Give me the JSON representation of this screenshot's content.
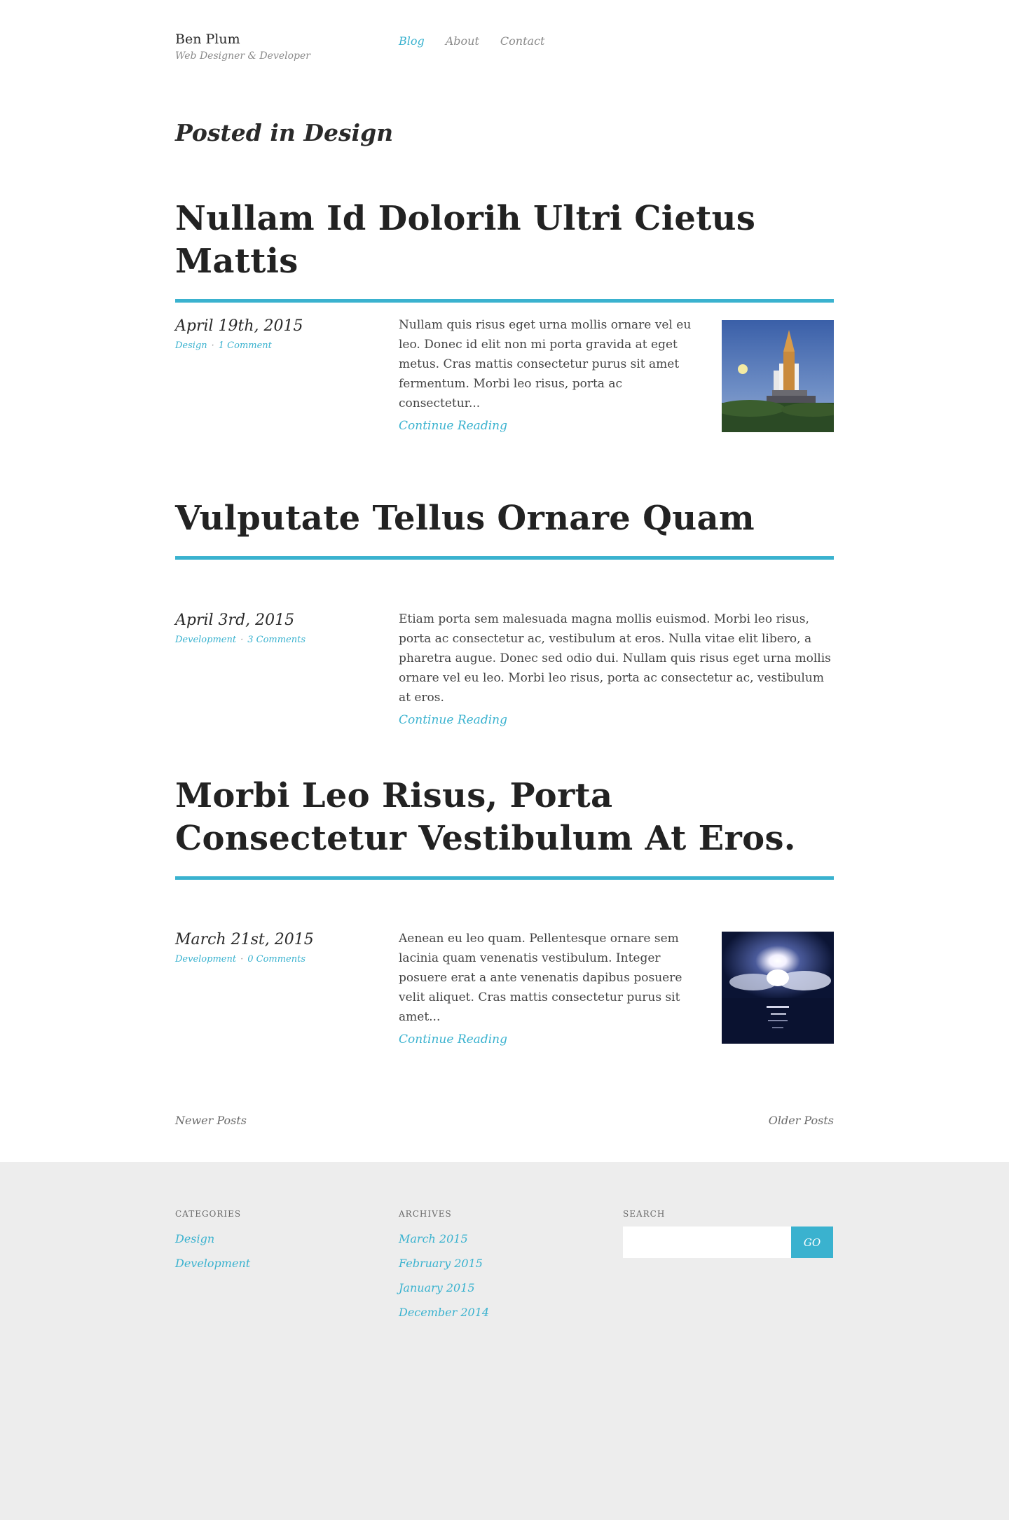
{
  "header": {
    "site_name": "Ben Plum",
    "tagline": "Web Designer & Developer",
    "nav": [
      {
        "label": "Blog",
        "active": true
      },
      {
        "label": "About",
        "active": false
      },
      {
        "label": "Contact",
        "active": false
      }
    ]
  },
  "archive_title": "Posted in Design",
  "posts": [
    {
      "title": "Nullam Id Dolorih Ultri Cietus Mattis",
      "date": "April 19th, 2015",
      "category": "Design",
      "separator": "·",
      "comments": "1 Comment",
      "excerpt": "Nullam quis risus eget urna mollis ornare vel eu leo. Donec id elit non mi porta gravida at eget metus. Cras mattis consectetur purus sit amet fermentum. Morbi leo risus, porta ac consectetur...",
      "read_more": "Continue Reading",
      "thumbnail": "shuttle-on-launchpad"
    },
    {
      "title": "Vulputate Tellus Ornare Quam",
      "date": "April 3rd, 2015",
      "category": "Development",
      "separator": "·",
      "comments": "3 Comments",
      "excerpt": "Etiam porta sem malesuada magna mollis euismod. Morbi leo risus, porta ac consectetur ac, vestibulum at eros. Nulla vitae elit libero, a pharetra augue. Donec sed odio dui. Nullam quis risus eget urna mollis ornare vel eu leo. Morbi leo risus, porta ac consectetur ac, vestibulum at eros.",
      "read_more": "Continue Reading"
    },
    {
      "title": "Morbi Leo Risus, Porta Consectetur Vestibulum At Eros.",
      "date": "March 21st, 2015",
      "category": "Development",
      "separator": "·",
      "comments": "0 Comments",
      "excerpt": "Aenean eu leo quam. Pellentesque ornare sem lacinia quam venenatis vestibulum. Integer posuere erat a ante venenatis dapibus posuere velit aliquet. Cras mattis consectetur purus sit amet...",
      "read_more": "Continue Reading",
      "thumbnail": "night-launch"
    }
  ],
  "pagination": {
    "newer": "Newer Posts",
    "older": "Older Posts"
  },
  "footer": {
    "categories": {
      "heading": "CATEGORIES",
      "items": [
        "Design",
        "Development"
      ]
    },
    "archives": {
      "heading": "ARCHIVES",
      "items": [
        "March 2015",
        "February 2015",
        "January 2015",
        "December 2014"
      ]
    },
    "search": {
      "heading": "SEARCH",
      "placeholder": "",
      "button": "GO"
    }
  },
  "colors": {
    "accent": "#3ab2cf",
    "footer_bg": "#ededed",
    "text_dark": "#222222"
  }
}
